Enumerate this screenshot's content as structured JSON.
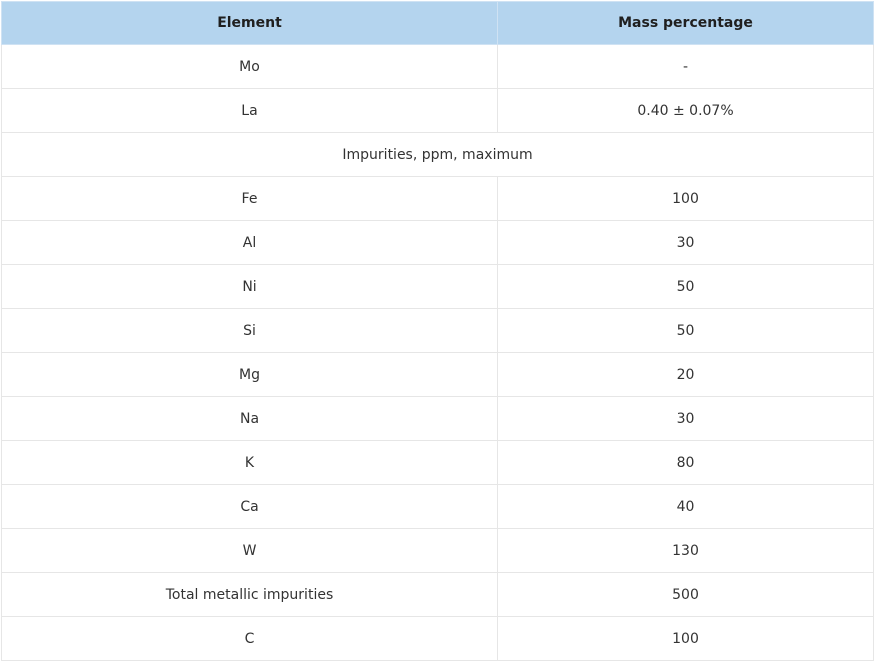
{
  "table": {
    "headers": [
      "Element",
      "Mass percentage"
    ],
    "rows": [
      {
        "element": "Mo",
        "value": "-"
      },
      {
        "element": "La",
        "value": "0.40 ± 0.07%"
      },
      {
        "section": "Impurities, ppm, maximum"
      },
      {
        "element": "Fe",
        "value": "100"
      },
      {
        "element": "Al",
        "value": "30"
      },
      {
        "element": "Ni",
        "value": "50"
      },
      {
        "element": "Si",
        "value": "50"
      },
      {
        "element": "Mg",
        "value": "20"
      },
      {
        "element": "Na",
        "value": "30"
      },
      {
        "element": "K",
        "value": "80"
      },
      {
        "element": "Ca",
        "value": "40"
      },
      {
        "element": "W",
        "value": "130"
      },
      {
        "element": "Total metallic impurities",
        "value": "500"
      },
      {
        "element": "C",
        "value": "100"
      }
    ]
  }
}
